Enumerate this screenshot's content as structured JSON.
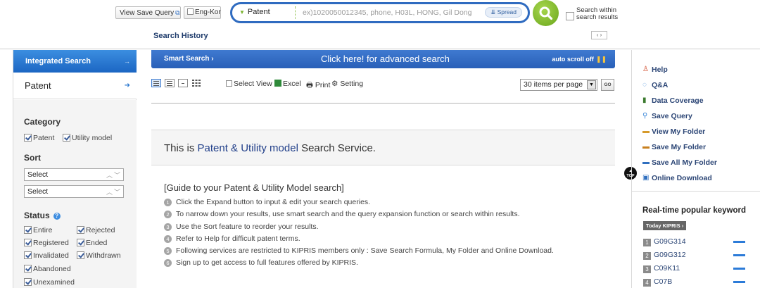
{
  "header": {
    "view_save_query": "View Save Query",
    "eng_kor": "Eng-Kor",
    "search_scope": "Patent",
    "search_placeholder": "ex)1020050012345, phone, H03L, HONG, Gil Dong",
    "spread": "Spread",
    "search_within_line1": "Search within",
    "search_within_line2": "search results",
    "search_history": "Search History"
  },
  "sidebar": {
    "integrated_search": "Integrated Search",
    "patent": "Patent",
    "category_title": "Category",
    "category_options": [
      "Patent",
      "Utility model"
    ],
    "sort_title": "Sort",
    "sort_selects": [
      "Select",
      "Select"
    ],
    "status_title": "Status",
    "status_options": [
      "Entire",
      "Rejected",
      "Registered",
      "Ended",
      "Invalidated",
      "Withdrawn",
      "Abandoned",
      "Unexamined"
    ]
  },
  "main": {
    "smart_search": "Smart Search",
    "click_here": "Click here!",
    "advanced_search": "for advanced search",
    "auto_scroll": "auto scroll off",
    "toolbar": {
      "select_view": "Select View",
      "excel": "Excel",
      "print": "Print",
      "setting": "Setting",
      "items_per_page": "30 items per page",
      "go": "GO"
    },
    "service_prefix": "This is ",
    "service_highlight": "Patent & Utility model",
    "service_suffix": " Search Service.",
    "guide_title": "[Guide to your Patent & Utility Model search]",
    "guide_items": [
      "Click the Expand button to input & edit your search queries.",
      "To narrow down your results, use smart search and the query expansion function or search within results.",
      "Use the Sort feature to reorder your results.",
      "Refer to Help for difficult patent terms.",
      "Following services are restricted to KIPRIS members only : Save Search Formula, My Folder and Online Download.",
      "Sign up to get access to full features offered by KIPRIS."
    ]
  },
  "right": {
    "links": [
      "Help",
      "Q&A",
      "Data Coverage",
      "Save Query",
      "View My Folder",
      "Save My Folder",
      "Save All My Folder",
      "Online Download"
    ],
    "top_label": "TOP",
    "popular_title": "Real-time popular keyword",
    "today_kipris": "Today KIPRIS",
    "keywords": [
      "G09G314",
      "G09G312",
      "C09K11",
      "C07B"
    ],
    "keyword_ranks": [
      "1",
      "2",
      "3",
      "4"
    ]
  },
  "colors": {
    "accent_blue": "#2f6bc0",
    "go_green": "#7ab22e",
    "trend_blue": "#2c7bd8"
  }
}
